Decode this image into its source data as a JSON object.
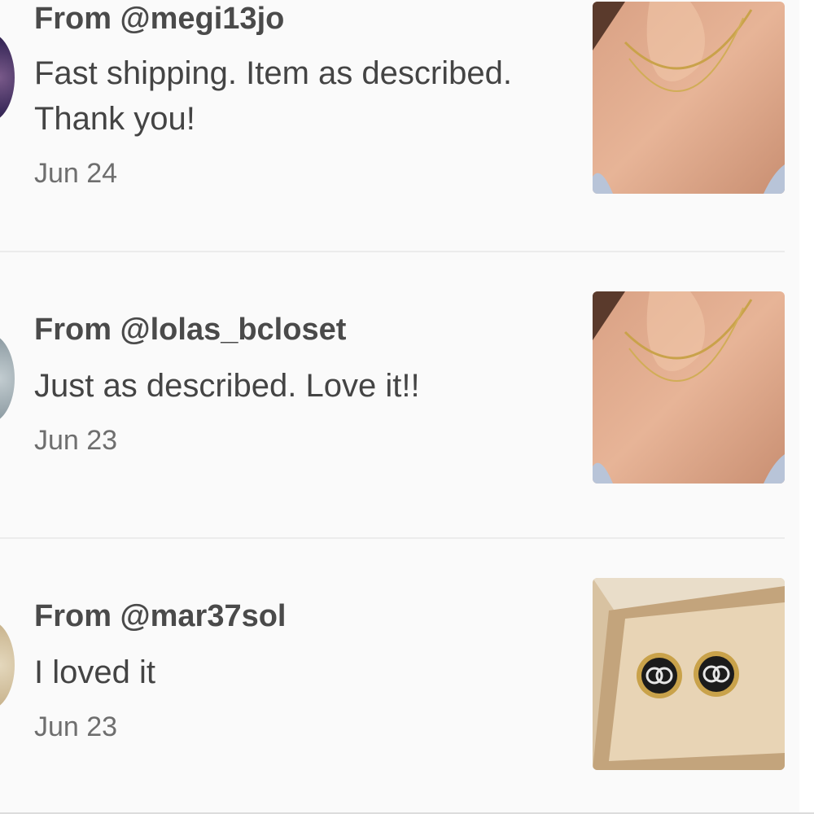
{
  "reviews": [
    {
      "from": "From @megi13jo",
      "text": "Fast shipping. Item as described. Thank you!",
      "date": "Jun 24",
      "thumbnail_icon": "gold-necklace-photo",
      "avatar_color": "#4b3a6b"
    },
    {
      "from": "From @lolas_bcloset",
      "text": "Just as described. Love it!!",
      "date": "Jun 23",
      "thumbnail_icon": "gold-necklace-photo",
      "avatar_color": "#9aa7ad"
    },
    {
      "from": "From @mar37sol",
      "text": "I loved it",
      "date": "Jun 23",
      "thumbnail_icon": "earrings-photo",
      "avatar_color": "#d7c9a8"
    }
  ],
  "colors": {
    "background": "#fafafa",
    "divider": "#ececec",
    "text_primary": "#4a4a4a",
    "text_secondary": "#6e6e6e"
  }
}
